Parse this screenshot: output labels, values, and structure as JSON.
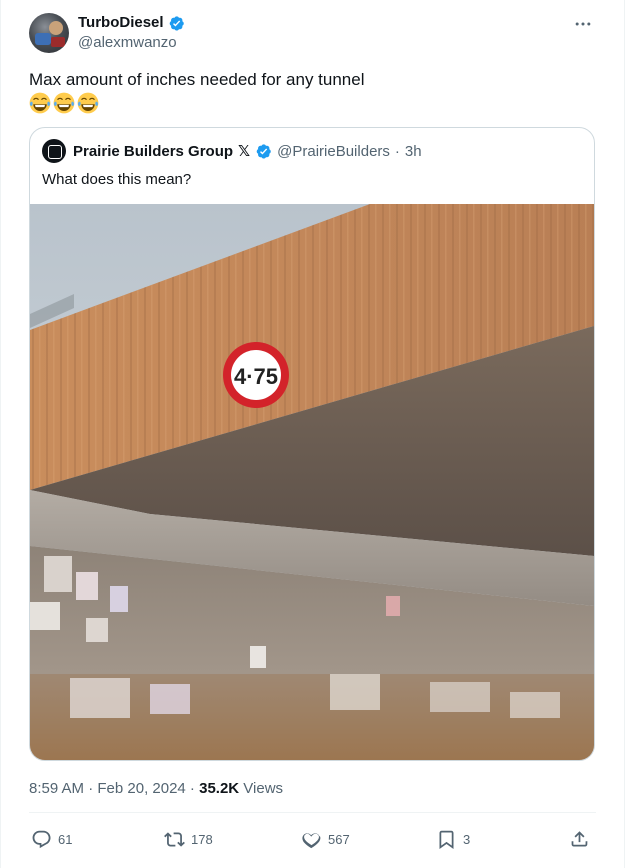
{
  "author": {
    "display_name": "TurboDiesel",
    "handle": "@alexmwanzo",
    "verified": true
  },
  "tweet": {
    "text": "Max amount of inches needed for any tunnel",
    "emojis": [
      "face-with-tears-of-joy",
      "face-with-tears-of-joy",
      "face-with-tears-of-joy"
    ]
  },
  "quoted_tweet": {
    "display_name": "Prairie Builders Group",
    "badge": "𝕏",
    "verified": true,
    "handle": "@PrairieBuilders",
    "separator": "·",
    "time": "3h",
    "text": "What does this mean?",
    "image": {
      "subject": "concrete-bridge-underpass",
      "sign_text": "4·75"
    }
  },
  "meta": {
    "timestamp": "8:59 AM · Feb 20, 2024 · ",
    "views_count": "35.2K",
    "views_label": " Views"
  },
  "actions": {
    "replies": "61",
    "reposts": "178",
    "likes": "567",
    "bookmarks": "3"
  },
  "colors": {
    "text_primary": "#0f1419",
    "text_secondary": "#536471",
    "verified_blue": "#1d9bf0",
    "border": "#cfd9de"
  },
  "icons": {
    "more": "more-horizontal-icon",
    "verified": "verified-badge-icon",
    "reply": "reply-icon",
    "repost": "repost-icon",
    "like": "heart-icon",
    "bookmark": "bookmark-icon",
    "share": "share-icon"
  }
}
